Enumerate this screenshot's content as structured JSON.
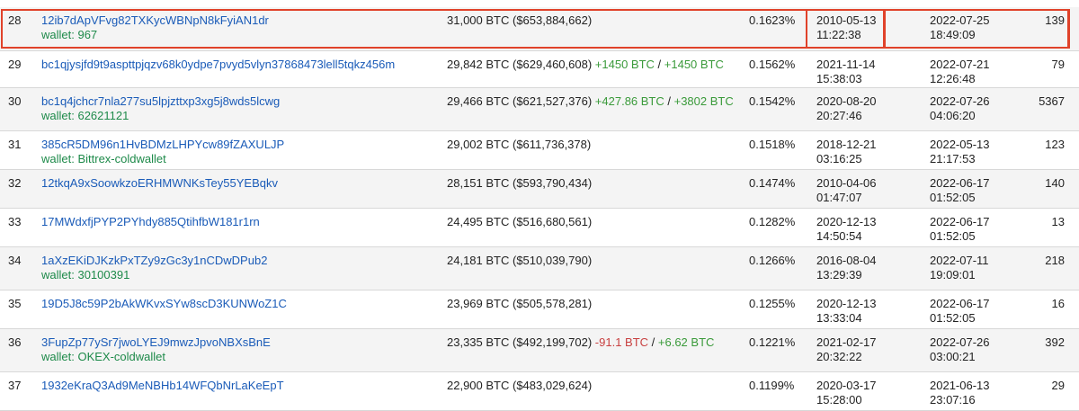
{
  "rows": [
    {
      "rank": "28",
      "address": "12ib7dApVFvg82TXKycWBNpN8kFyiAN1dr",
      "wallet": "wallet: 967",
      "balance": "31,000 BTC ($653,884,662)",
      "change_out": "",
      "change_sep": "",
      "change_in": "",
      "percent": "0.1623%",
      "first_date": "2010-05-13",
      "first_time": "11:22:38",
      "last_date": "2022-07-25",
      "last_time": "18:49:09",
      "count": "139"
    },
    {
      "rank": "29",
      "address": "bc1qjysjfd9t9aspttpjqzv68k0ydpe7pvyd5vlyn37868473lell5tqkz456m",
      "wallet": "",
      "balance": "29,842 BTC ($629,460,608)",
      "change_out": "+1450 BTC",
      "change_sep": " / ",
      "change_in": "+1450 BTC",
      "percent": "0.1562%",
      "first_date": "2021-11-14",
      "first_time": "15:38:03",
      "last_date": "2022-07-21",
      "last_time": "12:26:48",
      "count": "79"
    },
    {
      "rank": "30",
      "address": "bc1q4jchcr7nla277su5lpjzttxp3xg5j8wds5lcwg",
      "wallet": "wallet: 62621121",
      "balance": "29,466 BTC ($621,527,376)",
      "change_out": "+427.86 BTC",
      "change_sep": " / ",
      "change_in": "+3802 BTC",
      "percent": "0.1542%",
      "first_date": "2020-08-20",
      "first_time": "20:27:46",
      "last_date": "2022-07-26",
      "last_time": "04:06:20",
      "count": "5367"
    },
    {
      "rank": "31",
      "address": "385cR5DM96n1HvBDMzLHPYcw89fZAXULJP",
      "wallet": "wallet: Bittrex-coldwallet",
      "balance": "29,002 BTC ($611,736,378)",
      "change_out": "",
      "change_sep": "",
      "change_in": "",
      "percent": "0.1518%",
      "first_date": "2018-12-21",
      "first_time": "03:16:25",
      "last_date": "2022-05-13",
      "last_time": "21:17:53",
      "count": "123"
    },
    {
      "rank": "32",
      "address": "12tkqA9xSoowkzoERHMWNKsTey55YEBqkv",
      "wallet": "",
      "balance": "28,151 BTC ($593,790,434)",
      "change_out": "",
      "change_sep": "",
      "change_in": "",
      "percent": "0.1474%",
      "first_date": "2010-04-06",
      "first_time": "01:47:07",
      "last_date": "2022-06-17",
      "last_time": "01:52:05",
      "count": "140"
    },
    {
      "rank": "33",
      "address": "17MWdxfjPYP2PYhdy885QtihfbW181r1rn",
      "wallet": "",
      "balance": "24,495 BTC ($516,680,561)",
      "change_out": "",
      "change_sep": "",
      "change_in": "",
      "percent": "0.1282%",
      "first_date": "2020-12-13",
      "first_time": "14:50:54",
      "last_date": "2022-06-17",
      "last_time": "01:52:05",
      "count": "13"
    },
    {
      "rank": "34",
      "address": "1aXzEKiDJKzkPxTZy9zGc3y1nCDwDPub2",
      "wallet": "wallet: 30100391",
      "balance": "24,181 BTC ($510,039,790)",
      "change_out": "",
      "change_sep": "",
      "change_in": "",
      "percent": "0.1266%",
      "first_date": "2016-08-04",
      "first_time": "13:29:39",
      "last_date": "2022-07-11",
      "last_time": "19:09:01",
      "count": "218"
    },
    {
      "rank": "35",
      "address": "19D5J8c59P2bAkWKvxSYw8scD3KUNWoZ1C",
      "wallet": "",
      "balance": "23,969 BTC ($505,578,281)",
      "change_out": "",
      "change_sep": "",
      "change_in": "",
      "percent": "0.1255%",
      "first_date": "2020-12-13",
      "first_time": "13:33:04",
      "last_date": "2022-06-17",
      "last_time": "01:52:05",
      "count": "16"
    },
    {
      "rank": "36",
      "address": "3FupZp77ySr7jwoLYEJ9mwzJpvoNBXsBnE",
      "wallet": "wallet: OKEX-coldwallet",
      "balance": "23,335 BTC ($492,199,702)",
      "change_out": "-91.1 BTC",
      "change_sep": " / ",
      "change_in": "+6.62 BTC",
      "percent": "0.1221%",
      "first_date": "2021-02-17",
      "first_time": "20:32:22",
      "last_date": "2022-07-26",
      "last_time": "03:00:21",
      "count": "392"
    },
    {
      "rank": "37",
      "address": "1932eKraQ3Ad9MeNBHb14WFQbNrLaKeEpT",
      "wallet": "",
      "balance": "22,900 BTC ($483,029,624)",
      "change_out": "",
      "change_sep": "",
      "change_in": "",
      "percent": "0.1199%",
      "first_date": "2020-03-17",
      "first_time": "15:28:00",
      "last_date": "2021-06-13",
      "last_time": "23:07:16",
      "count": "29"
    }
  ],
  "colors": {
    "link": "#1a5bb8",
    "wallet": "#1e8a4a",
    "positive": "#3a9a3a",
    "negative": "#c84040",
    "highlight": "#e0422a"
  }
}
